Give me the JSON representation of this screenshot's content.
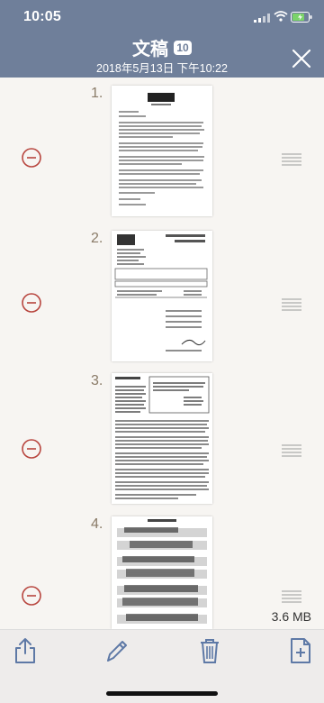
{
  "status": {
    "time": "10:05"
  },
  "header": {
    "title": "文稿",
    "count": "10",
    "subtitle": "2018年5月13日 下午10:22"
  },
  "pages": [
    {
      "number": "1."
    },
    {
      "number": "2."
    },
    {
      "number": "3."
    },
    {
      "number": "4."
    }
  ],
  "file_size": "3.6 MB",
  "colors": {
    "header": "#6f7f9a",
    "remove": "#b8463f",
    "toolbar_icons": "#5e79a6"
  },
  "icons": {
    "close": "close-icon",
    "remove": "minus-circle-icon",
    "reorder": "drag-handle-icon",
    "share": "share-icon",
    "edit": "pencil-icon",
    "delete": "trash-icon",
    "add_page": "add-page-icon"
  }
}
